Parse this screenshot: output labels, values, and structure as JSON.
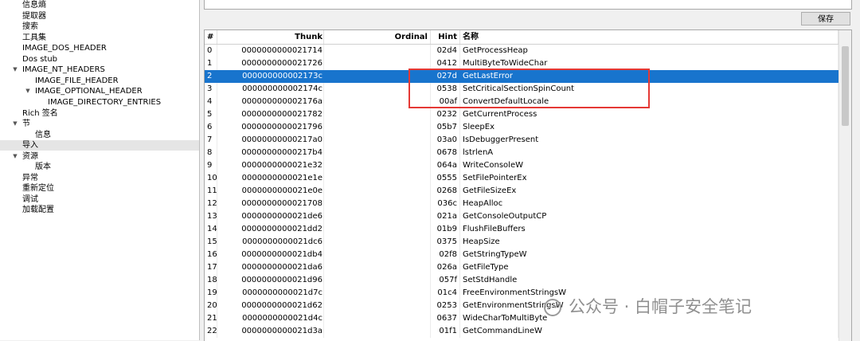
{
  "tree": [
    {
      "label": "信息熵",
      "indent": 1,
      "arrow": ""
    },
    {
      "label": "提取器",
      "indent": 1,
      "arrow": ""
    },
    {
      "label": "搜索",
      "indent": 1,
      "arrow": ""
    },
    {
      "label": "工具集",
      "indent": 1,
      "arrow": ""
    },
    {
      "label": "IMAGE_DOS_HEADER",
      "indent": 1,
      "arrow": ""
    },
    {
      "label": "Dos stub",
      "indent": 1,
      "arrow": ""
    },
    {
      "label": "IMAGE_NT_HEADERS",
      "indent": 1,
      "arrow": "▼"
    },
    {
      "label": "IMAGE_FILE_HEADER",
      "indent": 2,
      "arrow": ""
    },
    {
      "label": "IMAGE_OPTIONAL_HEADER",
      "indent": 2,
      "arrow": "▼"
    },
    {
      "label": "IMAGE_DIRECTORY_ENTRIES",
      "indent": 3,
      "arrow": ""
    },
    {
      "label": "Rich 签名",
      "indent": 1,
      "arrow": ""
    },
    {
      "label": "节",
      "indent": 1,
      "arrow": "▼"
    },
    {
      "label": "信息",
      "indent": 2,
      "arrow": ""
    },
    {
      "label": "导入",
      "indent": 1,
      "arrow": "",
      "selected": true
    },
    {
      "label": "资源",
      "indent": 1,
      "arrow": "▼"
    },
    {
      "label": "版本",
      "indent": 2,
      "arrow": ""
    },
    {
      "label": "异常",
      "indent": 1,
      "arrow": ""
    },
    {
      "label": "重新定位",
      "indent": 1,
      "arrow": ""
    },
    {
      "label": "调试",
      "indent": 1,
      "arrow": ""
    },
    {
      "label": "加载配置",
      "indent": 1,
      "arrow": ""
    }
  ],
  "save_label": "保存",
  "columns": {
    "idx": "#",
    "thunk": "Thunk",
    "ordinal": "Ordinal",
    "hint": "Hint",
    "name": "名称"
  },
  "selected_row": 2,
  "highlight_rows": [
    2,
    3,
    4
  ],
  "rows": [
    [
      "0",
      "0000000000021714",
      "",
      "02d4",
      "GetProcessHeap"
    ],
    [
      "1",
      "0000000000021726",
      "",
      "0412",
      "MultiByteToWideChar"
    ],
    [
      "2",
      "000000000002173c",
      "",
      "027d",
      "GetLastError"
    ],
    [
      "3",
      "000000000002174c",
      "",
      "0538",
      "SetCriticalSectionSpinCount"
    ],
    [
      "4",
      "000000000002176a",
      "",
      "00af",
      "ConvertDefaultLocale"
    ],
    [
      "5",
      "0000000000021782",
      "",
      "0232",
      "GetCurrentProcess"
    ],
    [
      "6",
      "0000000000021796",
      "",
      "05b7",
      "SleepEx"
    ],
    [
      "7",
      "00000000000217a0",
      "",
      "03a0",
      "IsDebuggerPresent"
    ],
    [
      "8",
      "00000000000217b4",
      "",
      "0678",
      "lstrlenA"
    ],
    [
      "9",
      "0000000000021e32",
      "",
      "064a",
      "WriteConsoleW"
    ],
    [
      "10",
      "0000000000021e1e",
      "",
      "0555",
      "SetFilePointerEx"
    ],
    [
      "11",
      "0000000000021e0e",
      "",
      "0268",
      "GetFileSizeEx"
    ],
    [
      "12",
      "0000000000021708",
      "",
      "036c",
      "HeapAlloc"
    ],
    [
      "13",
      "0000000000021de6",
      "",
      "021a",
      "GetConsoleOutputCP"
    ],
    [
      "14",
      "0000000000021dd2",
      "",
      "01b9",
      "FlushFileBuffers"
    ],
    [
      "15",
      "0000000000021dc6",
      "",
      "0375",
      "HeapSize"
    ],
    [
      "16",
      "0000000000021db4",
      "",
      "02f8",
      "GetStringTypeW"
    ],
    [
      "17",
      "0000000000021da6",
      "",
      "026a",
      "GetFileType"
    ],
    [
      "18",
      "0000000000021d96",
      "",
      "057f",
      "SetStdHandle"
    ],
    [
      "19",
      "0000000000021d7c",
      "",
      "01c4",
      "FreeEnvironmentStringsW"
    ],
    [
      "20",
      "0000000000021d62",
      "",
      "0253",
      "GetEnvironmentStringsW"
    ],
    [
      "21",
      "0000000000021d4c",
      "",
      "0637",
      "WideCharToMultiByte"
    ],
    [
      "22",
      "0000000000021d3a",
      "",
      "01f1",
      "GetCommandLineW"
    ]
  ],
  "watermark": "公众号 · 白帽子安全笔记",
  "colors": {
    "selection": "#1874cd",
    "highlight_box": "#e53935"
  }
}
